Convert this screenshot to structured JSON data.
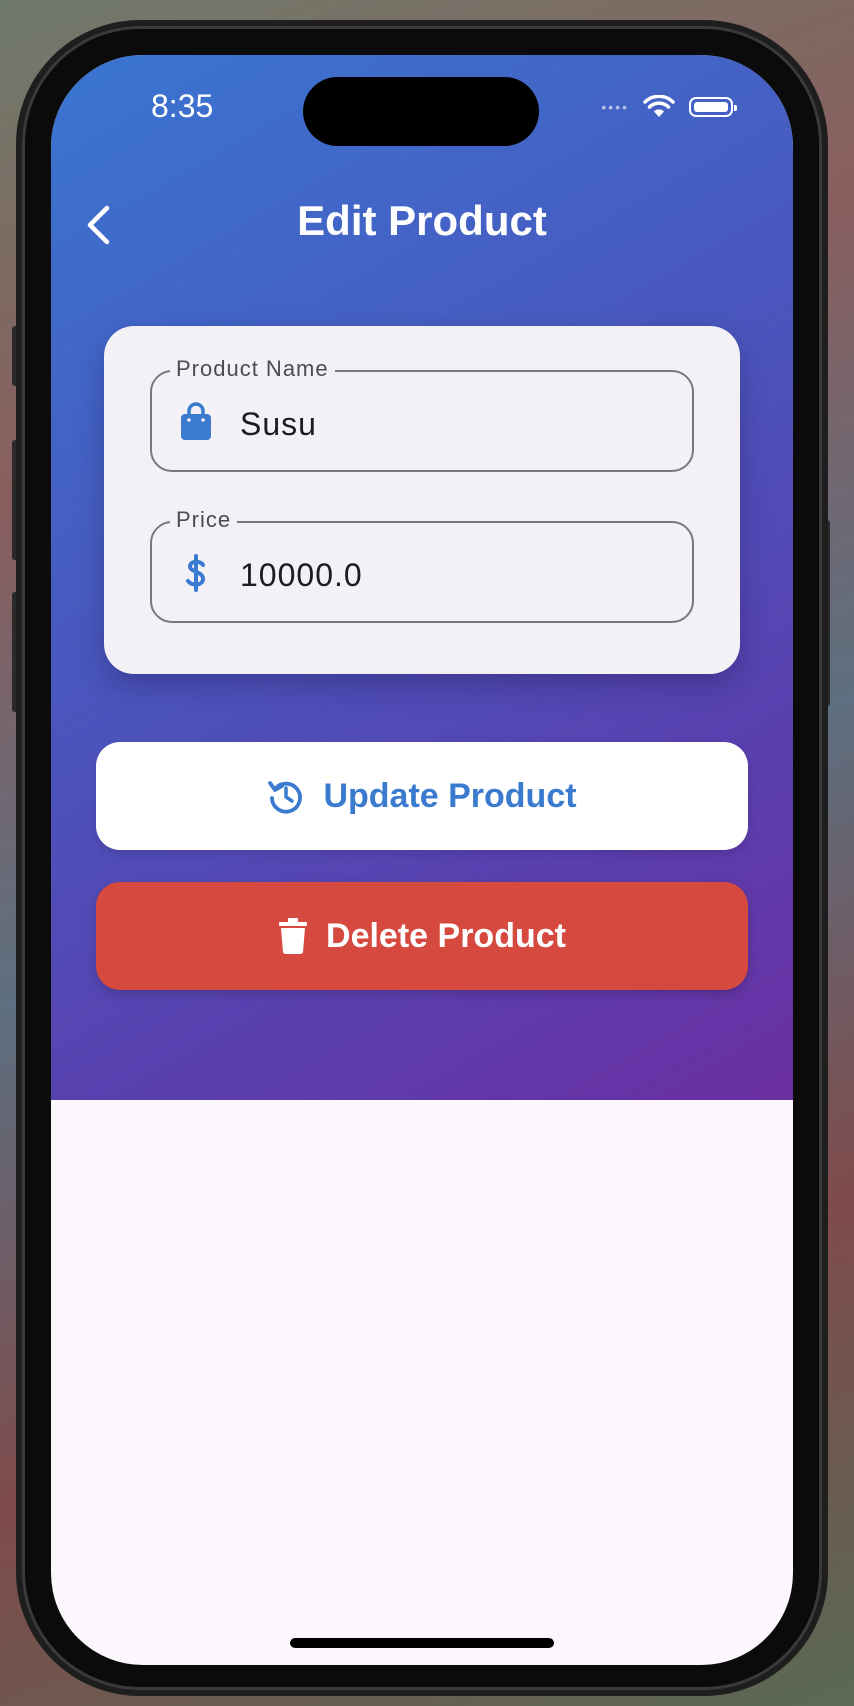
{
  "status_bar": {
    "time": "8:35",
    "signal_dots": "••••"
  },
  "header": {
    "title": "Edit Product"
  },
  "form": {
    "product_name": {
      "label": "Product Name",
      "value": "Susu"
    },
    "price": {
      "label": "Price",
      "value": "10000.0"
    }
  },
  "actions": {
    "update_label": "Update Product",
    "delete_label": "Delete Product"
  },
  "colors": {
    "accent": "#3a7bd0",
    "danger": "#d6493f",
    "gradient_start": "#3a76d2",
    "gradient_end": "#6b2fa2"
  },
  "icons": {
    "back": "chevron-left-icon",
    "product_name": "shopping-bag-icon",
    "price": "dollar-icon",
    "update": "refresh-clock-icon",
    "delete": "trash-icon"
  }
}
